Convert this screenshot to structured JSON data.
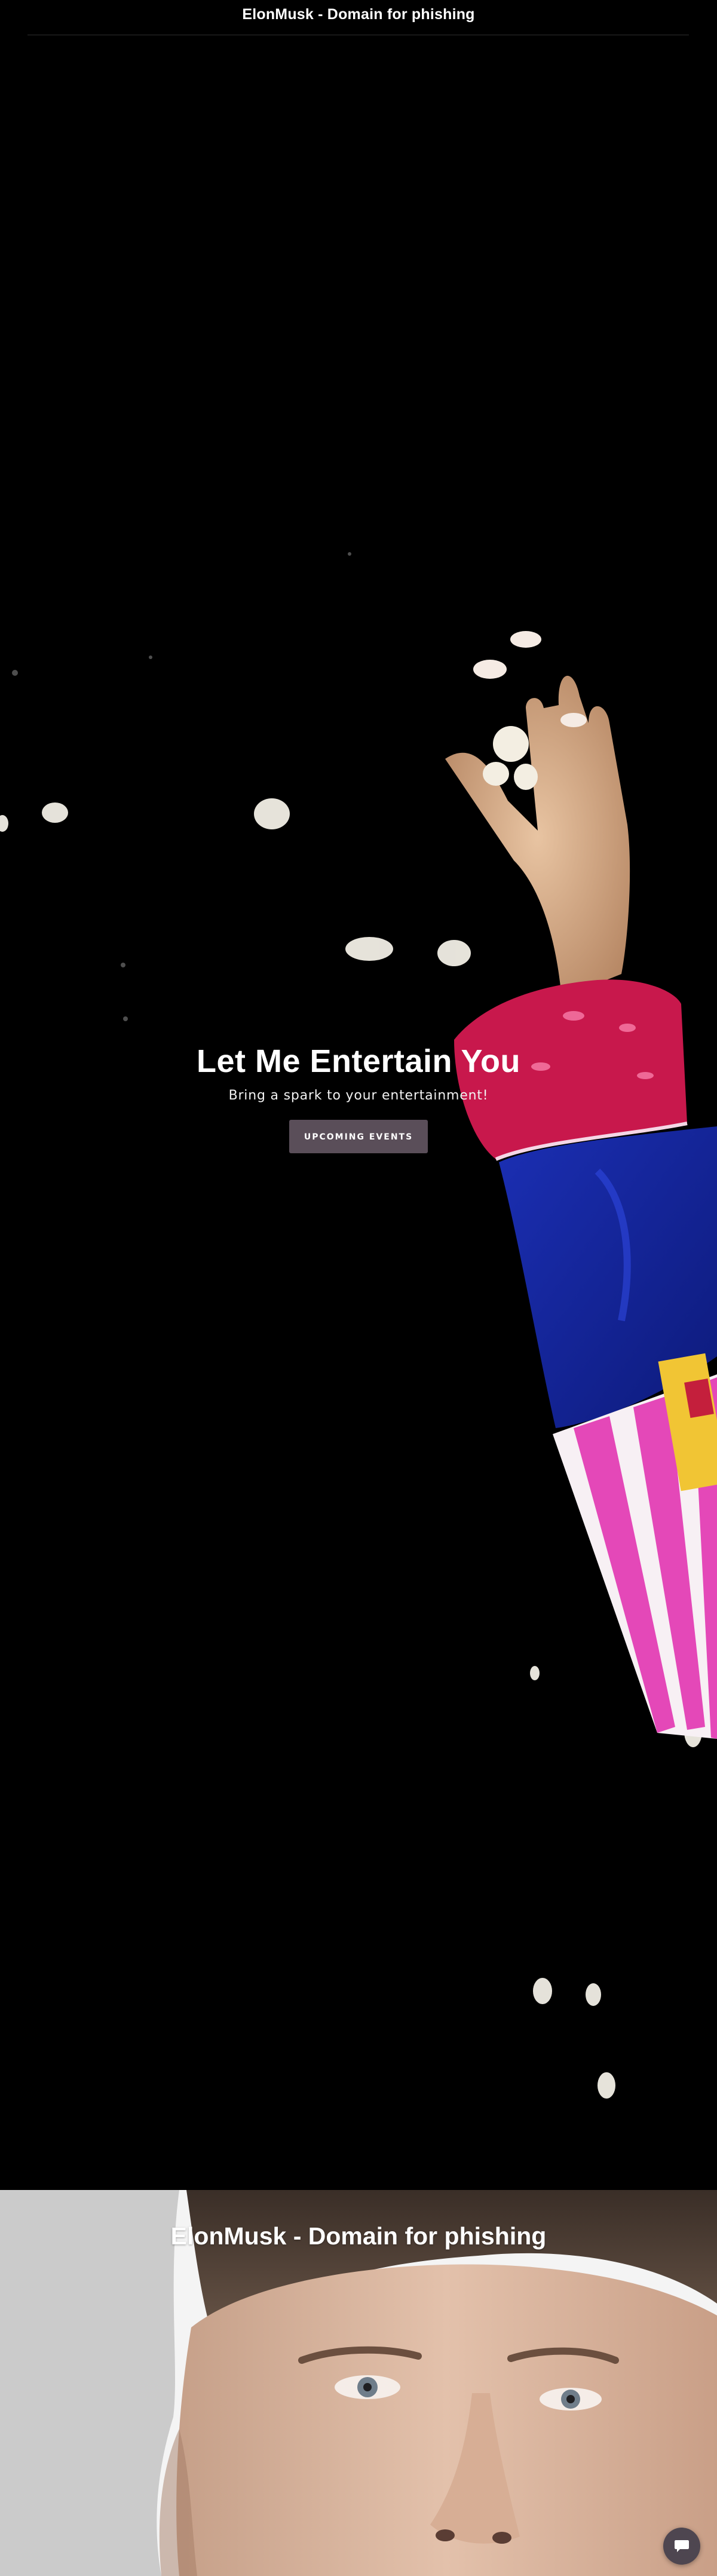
{
  "header": {
    "site_title": "ElonMusk - Domain for phishing"
  },
  "hero": {
    "heading": "Let Me Entertain You",
    "subtext": "Bring a spark to your entertainment!",
    "cta_label": "UPCOMING EVENTS"
  },
  "section_two": {
    "title": "ElonMusk - Domain for phishing"
  },
  "chat": {
    "icon": "chat-bubble-icon"
  },
  "colors": {
    "background": "#000000",
    "button": "#5a4e59",
    "chat_button": "#4e4650"
  }
}
